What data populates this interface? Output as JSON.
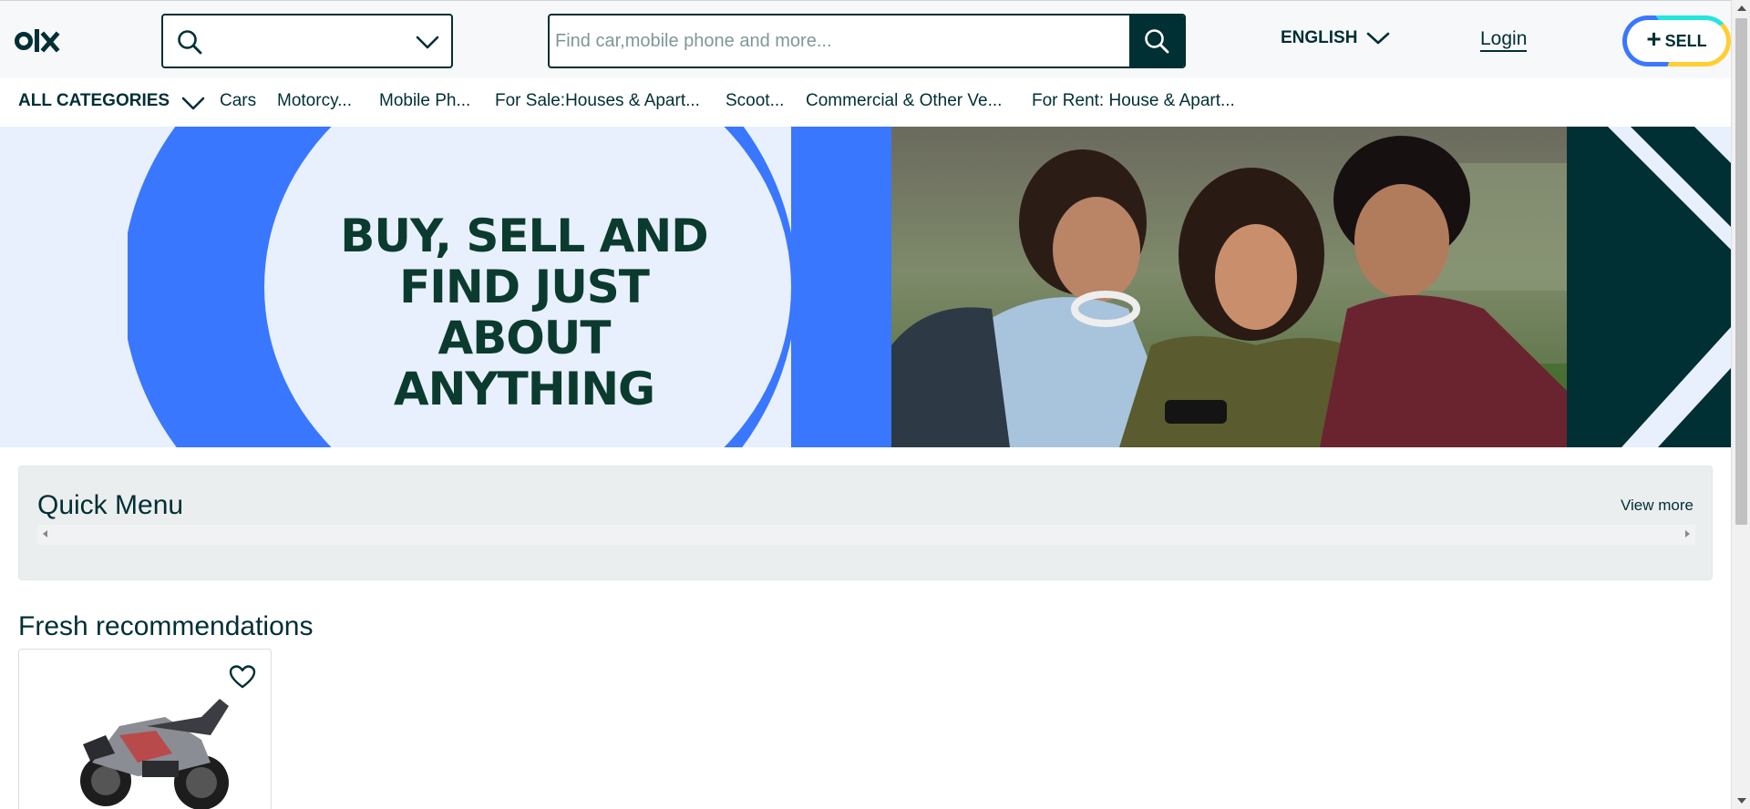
{
  "header": {
    "logo_text": "olx",
    "search_placeholder": "Find car,mobile phone and more...",
    "language": "ENGLISH",
    "login": "Login",
    "sell": "SELL"
  },
  "categories": {
    "all_label": "ALL CATEGORIES",
    "items": [
      "Cars",
      "Motorcy...",
      "Mobile Ph...",
      "For Sale:Houses & Apart...",
      "Scoot...",
      "Commercial & Other Ve...",
      "For Rent: House & Apart..."
    ]
  },
  "banner": {
    "tagline_line1": "BUY, SELL AND",
    "tagline_line2": "FIND JUST ABOUT",
    "tagline_line3": "ANYTHING"
  },
  "quick_menu": {
    "title": "Quick Menu",
    "view_more": "View more"
  },
  "fresh": {
    "title": "Fresh recommendations"
  },
  "colors": {
    "brand_dark": "#002f34",
    "brand_blue": "#3a77ff",
    "banner_bg": "#e8f0fd",
    "sell_yellow": "#ffce32",
    "sell_teal": "#23e5db"
  },
  "icons": {
    "logo": "olx-logo",
    "location_search": "search-icon",
    "location_dropdown": "chevron-down-icon",
    "search_submit": "search-icon",
    "language_dropdown": "chevron-down-icon",
    "sell_plus": "plus-icon",
    "category_dropdown": "chevron-down-icon",
    "favourite": "heart-icon"
  }
}
